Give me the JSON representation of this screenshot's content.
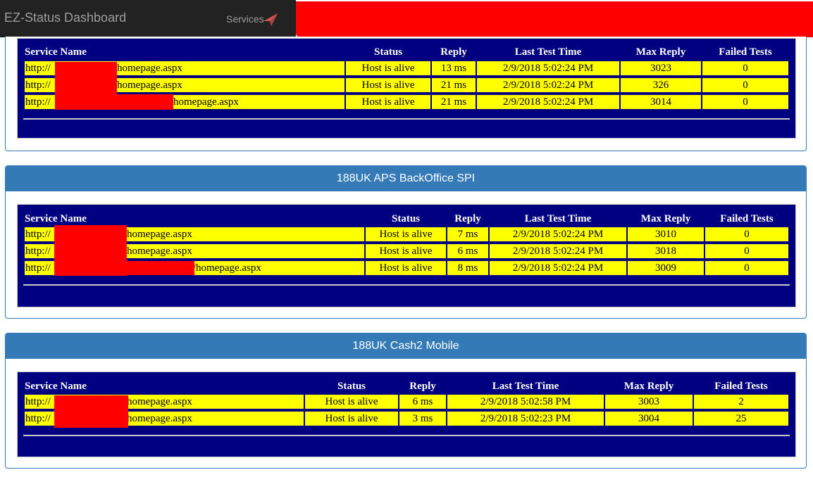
{
  "navbar": {
    "brand": "EZ-Status Dashboard",
    "services_label": "Services",
    "services_icon": "location-arrow-icon"
  },
  "columns": [
    "Service Name",
    "Status",
    "Reply",
    "Last Test Time",
    "Max Reply",
    "Failed Tests"
  ],
  "panels": [
    {
      "title": "",
      "rows": [
        {
          "url_prefix": "http://",
          "url_suffix": "/homepage.aspx",
          "status": "Host is alive",
          "reply": "13 ms",
          "last_test": "2/9/2018 5:02:24 PM",
          "max_reply": "3023",
          "failed": "0"
        },
        {
          "url_prefix": "http://",
          "url_suffix": "/homepage.aspx",
          "status": "Host is alive",
          "reply": "21 ms",
          "last_test": "2/9/2018 5:02:24 PM",
          "max_reply": "326",
          "failed": "0"
        },
        {
          "url_prefix": "http://",
          "url_suffix": "/homepage.aspx",
          "status": "Host is alive",
          "reply": "21 ms",
          "last_test": "2/9/2018 5:02:24 PM",
          "max_reply": "3014",
          "failed": "0"
        }
      ]
    },
    {
      "title": "188UK APS BackOffice SPI",
      "rows": [
        {
          "url_prefix": "http://",
          "url_suffix": "/homepage.aspx",
          "status": "Host is alive",
          "reply": "7 ms",
          "last_test": "2/9/2018 5:02:24 PM",
          "max_reply": "3010",
          "failed": "0"
        },
        {
          "url_prefix": "http://",
          "url_suffix": "/homepage.aspx",
          "status": "Host is alive",
          "reply": "6 ms",
          "last_test": "2/9/2018 5:02:24 PM",
          "max_reply": "3018",
          "failed": "0"
        },
        {
          "url_prefix": "http://",
          "url_suffix": "/homepage.aspx",
          "status": "Host is alive",
          "reply": "8 ms",
          "last_test": "2/9/2018 5:02:24 PM",
          "max_reply": "3009",
          "failed": "0"
        }
      ]
    },
    {
      "title": "188UK Cash2 Mobile",
      "rows": [
        {
          "url_prefix": "http://",
          "url_suffix": "/homepage.aspx",
          "status": "Host is alive",
          "reply": "6 ms",
          "last_test": "2/9/2018 5:02:58 PM",
          "max_reply": "3003",
          "failed": "2"
        },
        {
          "url_prefix": "http://",
          "url_suffix": "/homepage.aspx",
          "status": "Host is alive",
          "reply": "3 ms",
          "last_test": "2/9/2018 5:02:23 PM",
          "max_reply": "3004",
          "failed": "25"
        }
      ]
    }
  ],
  "colors": {
    "navbar_bg": "#222222",
    "panel_heading": "#337ab7",
    "table_bg": "#000080",
    "cell_bg": "#ffff00",
    "redaction": "#ff0000"
  }
}
